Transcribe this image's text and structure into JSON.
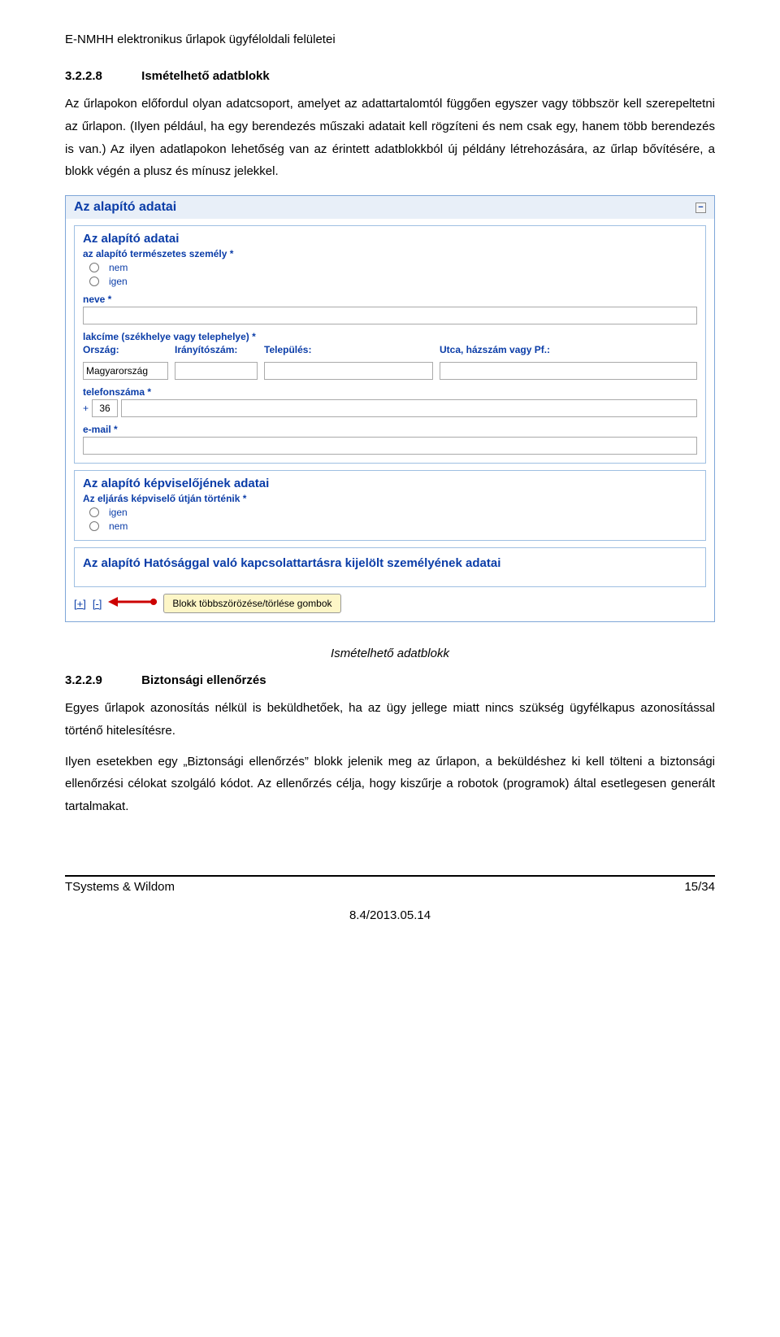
{
  "header": "E-NMHH elektronikus űrlapok ügyféloldali felületei",
  "sec1": {
    "num": "3.2.2.8",
    "title": "Ismételhető adatblokk",
    "p1": "Az űrlapokon előfordul olyan adatcsoport, amelyet az adattartalomtól függően egyszer vagy többször kell szerepeltetni az űrlapon. (Ilyen például, ha egy berendezés műszaki adatait kell rögzíteni és nem csak egy, hanem több berendezés is van.) Az ilyen adatlapokon lehetőség van az érintett adatblokkból új példány létrehozására, az űrlap bővítésére, a blokk végén a plusz és mínusz jelekkel."
  },
  "form": {
    "header": "Az alapító adatai",
    "block1": {
      "title": "Az alapító adatai",
      "q_natural": "az alapító természetes személy *",
      "opt_no": "nem",
      "opt_yes": "igen",
      "name_label": "neve *",
      "addr_group": "lakcíme (székhelye vagy telephelye) *",
      "addr_country": "Ország:",
      "addr_zip": "Irányítószám:",
      "addr_city": "Település:",
      "addr_street": "Utca, házszám vagy Pf.:",
      "country_value": "Magyarország",
      "phone_label": "telefonszáma *",
      "phone_cc": "36",
      "email_label": "e-mail *"
    },
    "block2": {
      "title": "Az alapító képviselőjének adatai",
      "q_rep": "Az eljárás képviselő útján történik *",
      "opt_yes": "igen",
      "opt_no": "nem"
    },
    "block3": {
      "title": "Az alapító Hatósággal való kapcsolattartásra kijelölt személyének adatai"
    },
    "plus": "[+]",
    "minus": "[-]",
    "callout": "Blokk többszörözése/törlése gombok"
  },
  "caption": "Ismételhető adatblokk",
  "sec2": {
    "num": "3.2.2.9",
    "title": "Biztonsági ellenőrzés",
    "p1": "Egyes űrlapok azonosítás nélkül is beküldhetőek, ha az ügy jellege miatt nincs szükség ügyfélkapus azonosítással történő hitelesítésre.",
    "p2": "Ilyen esetekben egy „Biztonsági ellenőrzés” blokk jelenik meg az űrlapon, a beküldéshez ki kell tölteni a biztonsági ellenőrzési célokat szolgáló kódot. Az ellenőrzés célja, hogy kiszűrje a robotok (programok) által esetlegesen generált tartalmakat."
  },
  "footer": {
    "left": "TSystems & Wildom",
    "right": "15/34",
    "date": "8.4/2013.05.14"
  }
}
